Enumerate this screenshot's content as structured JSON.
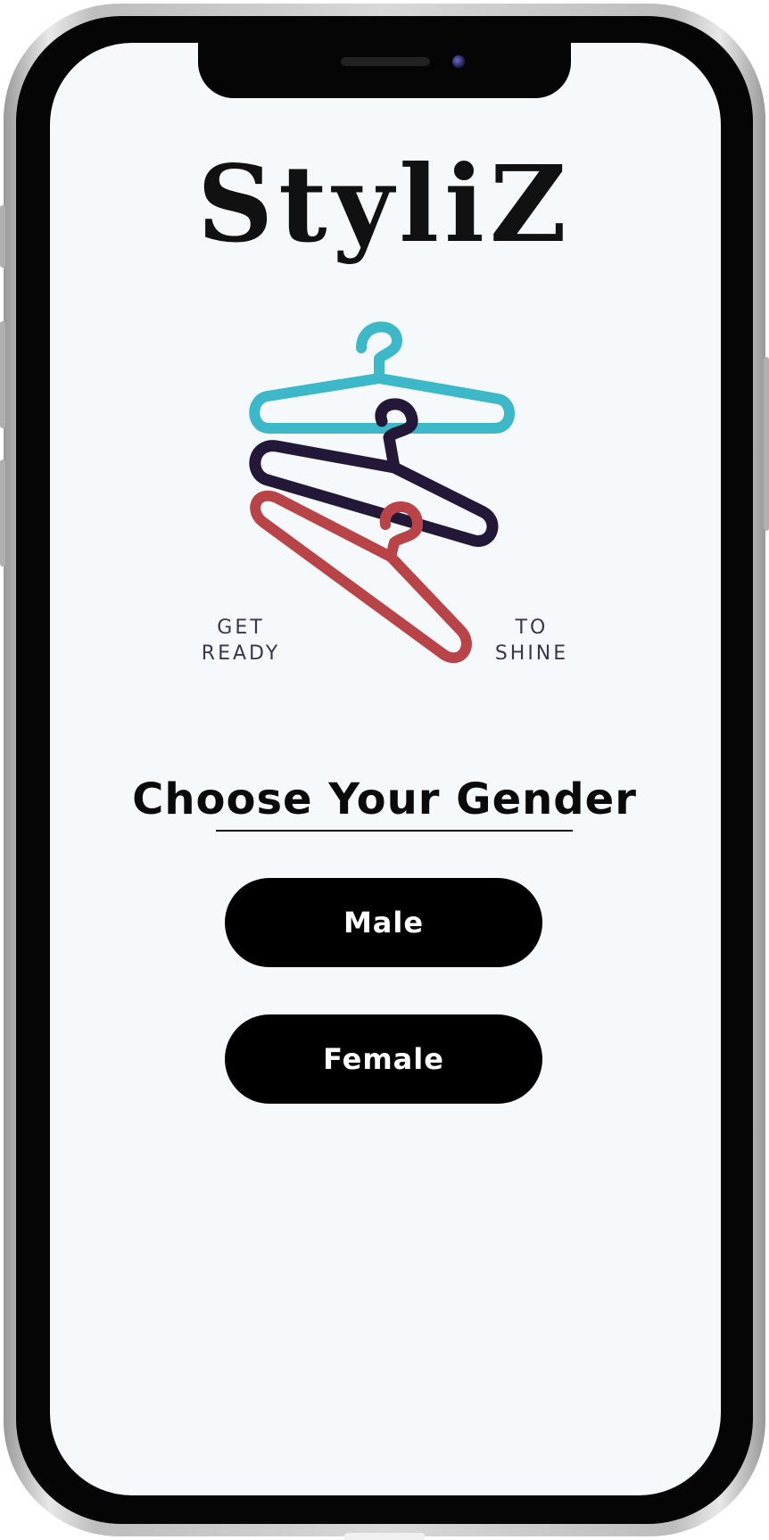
{
  "app": {
    "logo_text": "StyliZ"
  },
  "brand_art": {
    "tagline_left_line1": "GET",
    "tagline_left_line2": "READY",
    "tagline_right_line1": "TO",
    "tagline_right_line2": "SHINE",
    "hanger_colors": {
      "top": "#3cb8c9",
      "middle": "#231838",
      "bottom": "#b84448"
    }
  },
  "gender_screen": {
    "title": "Choose Your Gender",
    "male_label": "Male",
    "female_label": "Female"
  },
  "colors": {
    "screen_background": "#f5f9fc",
    "button_background": "#000000",
    "button_text": "#ffffff"
  }
}
